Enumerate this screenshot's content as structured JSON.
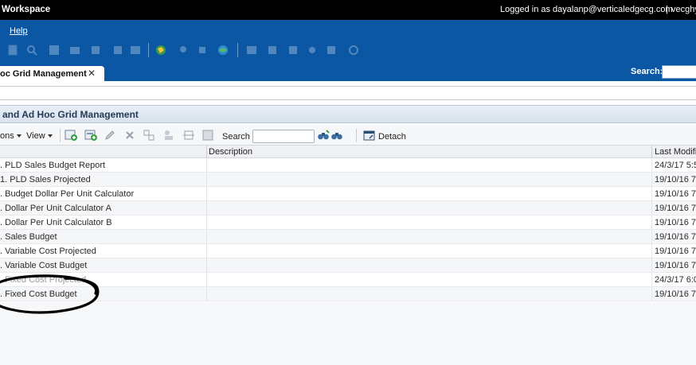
{
  "topbar": {
    "app_title": "Workspace",
    "login_text": "Logged in as dayalanp@verticaledgecg.com",
    "separator": "|",
    "user_short": "vecghy"
  },
  "menu": {
    "help_label": "Help"
  },
  "toolbar_icons": [
    "new-icon",
    "search-icon",
    "save-icon",
    "mail-icon",
    "tree-icon",
    "cube-icon",
    "globe-run-icon",
    "pin-icon",
    "globe-icon",
    "layout-icon",
    "insert-icon",
    "export-icon",
    "filter-icon",
    "sort-icon",
    "refresh-icon"
  ],
  "tab": {
    "label": "oc Grid Management",
    "close_glyph": "✕"
  },
  "header_search": {
    "label": "Search:",
    "value": ""
  },
  "address": {
    "value": ""
  },
  "panel": {
    "title": "and Ad Hoc Grid Management"
  },
  "grid_toolbar": {
    "actions_label": "ons",
    "view_label": "View",
    "search_label": "Search",
    "search_value": "",
    "detach_label": "Detach"
  },
  "columns": {
    "name": "",
    "description": "Description",
    "last_modified": "Last Modifie"
  },
  "rows": [
    {
      "name": ". PLD Sales Budget Report",
      "description": "",
      "modified": "24/3/17 5:5"
    },
    {
      "name": "1. PLD Sales Projected",
      "description": "",
      "modified": "19/10/16 7"
    },
    {
      "name": ". Budget Dollar Per Unit Calculator",
      "description": "",
      "modified": "19/10/16 7"
    },
    {
      "name": ". Dollar Per Unit Calculator A",
      "description": "",
      "modified": "19/10/16 7"
    },
    {
      "name": ". Dollar Per Unit Calculator B",
      "description": "",
      "modified": "19/10/16 7"
    },
    {
      "name": ". Sales Budget",
      "description": "",
      "modified": "19/10/16 7"
    },
    {
      "name": ". Variable Cost Projected",
      "description": "",
      "modified": "19/10/16 7"
    },
    {
      "name": ". Variable Cost Budget",
      "description": "",
      "modified": "19/10/16 7"
    },
    {
      "name": ". Fixed Cost Projected",
      "description": "",
      "modified": "24/3/17 6:0"
    },
    {
      "name": ". Fixed Cost Budget",
      "description": "",
      "modified": "19/10/16 7"
    }
  ],
  "colors": {
    "topbar_bg": "#000000",
    "header_blue": "#0c57a4",
    "panel_title": "#243a55",
    "annotation": "#000000"
  }
}
